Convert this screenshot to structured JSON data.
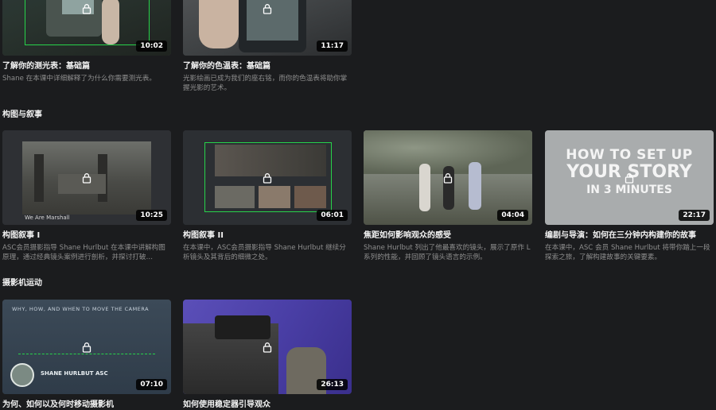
{
  "top_row": [
    {
      "title": "了解你的测光表：基础篇",
      "desc": "Shane 在本课中详细解释了为什么你需要测光表。",
      "duration": "10:02",
      "icon": "lock-icon"
    },
    {
      "title": "了解你的色温表：基础篇",
      "desc": "光影绘画已成为我们的座右铭，而你的色温表将助你掌握光影的艺术。",
      "duration": "11:17",
      "icon": "lock-icon"
    }
  ],
  "sections": [
    {
      "title": "构图与叙事",
      "cards": [
        {
          "title": "构图叙事 I",
          "desc": "ASC会员摄影指导 Shane Hurlbut 在本课中讲解构图原理，通过经典镜头案例进行剖析，并探讨打破…",
          "duration": "10:25",
          "thumb_text": "We Are Marshall"
        },
        {
          "title": "构图叙事 II",
          "desc": "在本课中，ASC会员摄影指导 Shane Hurlbut 继续分析镜头及其背后的细微之处。",
          "duration": "06:01"
        },
        {
          "title": "焦距如何影响观众的感受",
          "desc": "Shane Hurlbut 列出了他最喜欢的镜头，展示了原作 L 系列的性能，并回顾了镜头语言的示例。",
          "duration": "04:04"
        },
        {
          "title": "编剧与导演：如何在三分钟内构建你的故事",
          "desc": "在本课中，ASC 会员 Shane Hurlbut 将带你踏上一段探索之旅，了解构建故事的关键要素。",
          "duration": "22:17",
          "thumb_lines": [
            "HOW TO SET UP",
            "YOUR STORY",
            "IN 3 MINUTES"
          ]
        }
      ]
    },
    {
      "title": "摄影机运动",
      "cards": [
        {
          "title": "为何、如何以及何时移动摄影机",
          "desc": "",
          "duration": "07:10",
          "thumb_title": "WHY, HOW, AND WHEN TO MOVE THE CAMERA",
          "thumb_name": "SHANE HURLBUT ASC"
        },
        {
          "title": "如何使用稳定器引导观众",
          "desc": "",
          "duration": "26:13"
        }
      ]
    }
  ],
  "colors": {
    "accent_green": "#27d34a",
    "background": "#1b1c1e"
  }
}
